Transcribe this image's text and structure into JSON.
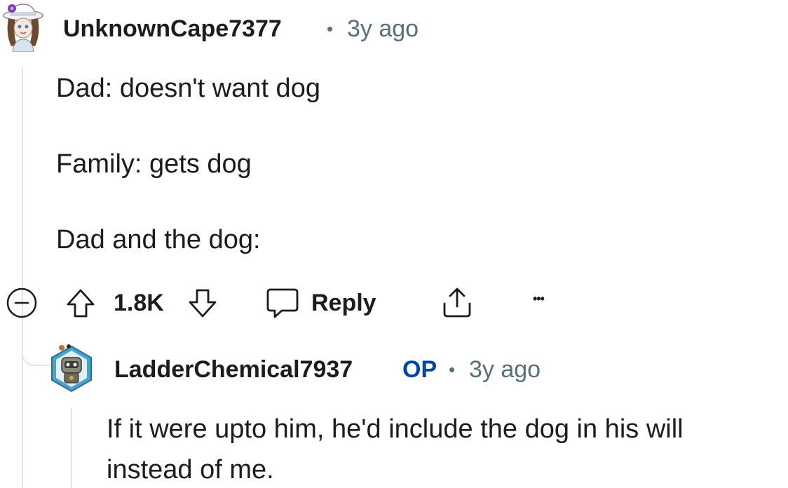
{
  "comment": {
    "username": "UnknownCape7377",
    "separator": "•",
    "timestamp": "3y ago",
    "lines": [
      "Dad: doesn't want dog",
      "Family: gets dog",
      "Dad and the dog:"
    ],
    "votes": "1.8K",
    "reply_label": "Reply",
    "more_label": "•••"
  },
  "reply": {
    "username": "LadderChemical7937",
    "op_badge": "OP",
    "separator": "•",
    "timestamp": "3y ago",
    "lines": [
      "If it were upto him, he'd include the dog in his will",
      "instead of me."
    ]
  },
  "colors": {
    "text": "#1c1c1c",
    "meta": "#576f76",
    "op": "#0045ac",
    "thread_line": "#e3e6e8"
  }
}
